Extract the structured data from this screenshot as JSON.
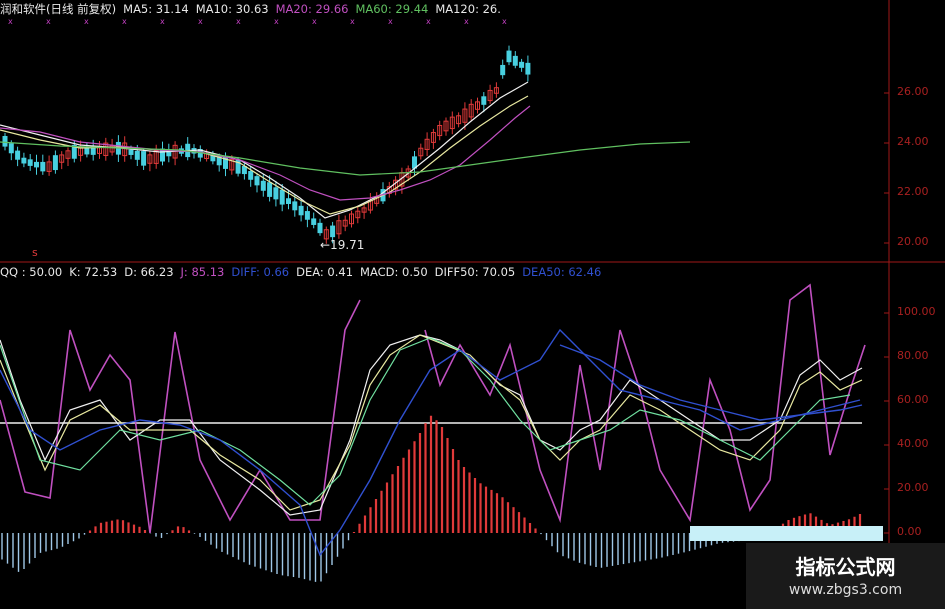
{
  "price_panel": {
    "legend": [
      {
        "text": "润和软件(日线 前复权)",
        "color": "#e8e8e8"
      },
      {
        "text": "MA5: 31.14",
        "color": "#e8e8e8"
      },
      {
        "text": "MA10: 30.63",
        "color": "#e8e8e8"
      },
      {
        "text": "MA20: 29.66",
        "color": "#c050c0"
      },
      {
        "text": "MA60: 29.44",
        "color": "#60c060"
      },
      {
        "text": "MA120: 26.",
        "color": "#e8e8e8"
      }
    ],
    "low_marker": "←19.71",
    "s_marker": "s",
    "y_labels": [
      {
        "text": "26.00",
        "value": 26
      },
      {
        "text": "24.00",
        "value": 24
      },
      {
        "text": "22.00",
        "value": 22
      },
      {
        "text": "20.00",
        "value": 20
      }
    ]
  },
  "indicator_panel": {
    "legend": [
      {
        "text": "QQ : 50.00",
        "color": "#e8e8e8"
      },
      {
        "text": "K: 72.53",
        "color": "#e8e8e8"
      },
      {
        "text": "D: 66.23",
        "color": "#e8e8e8"
      },
      {
        "text": "J: 85.13",
        "color": "#c050c0"
      },
      {
        "text": "DIFF: 0.66",
        "color": "#3050d0"
      },
      {
        "text": "DEA: 0.41",
        "color": "#e8e8e8"
      },
      {
        "text": "MACD: 0.50",
        "color": "#e8e8e8"
      },
      {
        "text": "DIFF50: 70.05",
        "color": "#e8e8e8"
      },
      {
        "text": "DEA50: 62.46",
        "color": "#3050d0"
      }
    ],
    "y_labels": [
      {
        "text": "100.00",
        "value": 100
      },
      {
        "text": "80.00",
        "value": 80
      },
      {
        "text": "60.00",
        "value": 60
      },
      {
        "text": "40.00",
        "value": 40
      },
      {
        "text": "20.00",
        "value": 20
      },
      {
        "text": "0.00",
        "value": 0
      }
    ]
  },
  "watermark": {
    "title": "指标公式网",
    "url": "www.zbgs3.com"
  },
  "colors": {
    "up": "#e03a3a",
    "down": "#48d0e0",
    "ma_purple": "#c050c0",
    "ma_green": "#60c060",
    "axis": "#a01818"
  }
}
